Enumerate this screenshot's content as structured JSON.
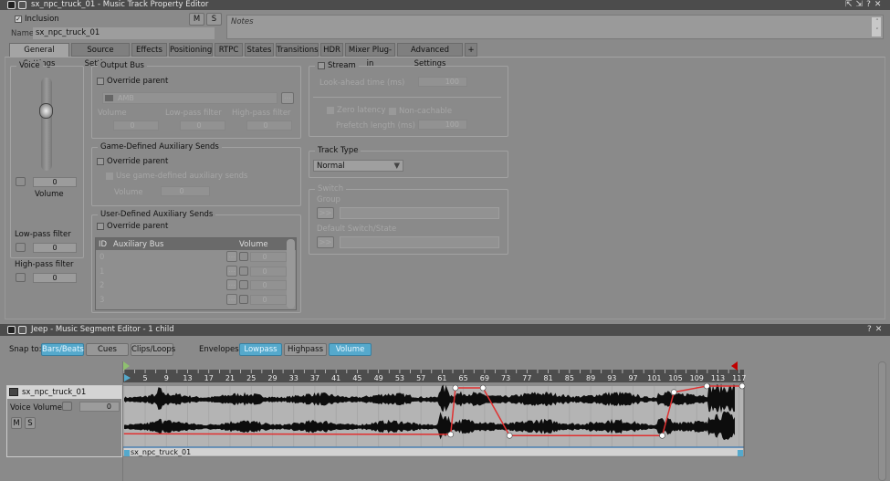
{
  "property_editor": {
    "title": "sx_npc_truck_01 - Music Track Property Editor",
    "inclusion_label": "Inclusion",
    "inclusion_checked": true,
    "mute_label": "M",
    "solo_label": "S",
    "name_label": "Name",
    "name_value": "sx_npc_truck_01",
    "notes_placeholder": "Notes",
    "window_buttons": [
      "float-icon",
      "dock-icon",
      "?",
      "×"
    ],
    "tabs": [
      "General Settings",
      "Source Settings",
      "Effects",
      "Positioning",
      "RTPC",
      "States",
      "Transitions",
      "HDR",
      "Mixer Plug-in",
      "Advanced Settings",
      "+"
    ],
    "active_tab": "General Settings",
    "voice": {
      "title": "Voice",
      "volume_value": "0",
      "volume_label": "Volume",
      "lowpass_label": "Low-pass filter",
      "lowpass_value": "0",
      "highpass_label": "High-pass filter",
      "highpass_value": "0"
    },
    "output_bus": {
      "title": "Output Bus",
      "override_label": "Override parent",
      "bus_name": "AMB",
      "browse_label": "...",
      "volume_label": "Volume",
      "volume_value": "0",
      "lowpass_label": "Low-pass filter",
      "lowpass_value": "0",
      "highpass_label": "High-pass filter",
      "highpass_value": "0"
    },
    "game_aux": {
      "title": "Game-Defined Auxiliary Sends",
      "override_label": "Override parent",
      "use_label": "Use game-defined auxiliary sends",
      "volume_label": "Volume",
      "volume_value": "0"
    },
    "user_aux": {
      "title": "User-Defined Auxiliary Sends",
      "override_label": "Override parent",
      "columns": [
        "ID",
        "Auxiliary Bus",
        "Volume"
      ],
      "rows": [
        {
          "id": "0",
          "bus": "",
          "volume": "0"
        },
        {
          "id": "1",
          "bus": "",
          "volume": "0"
        },
        {
          "id": "2",
          "bus": "",
          "volume": "0"
        },
        {
          "id": "3",
          "bus": "",
          "volume": "0"
        }
      ]
    },
    "stream": {
      "title": "Stream",
      "lookahead_label": "Look-ahead time (ms)",
      "lookahead_value": "100",
      "zero_latency_label": "Zero latency",
      "non_cachable_label": "Non-cachable",
      "prefetch_label": "Prefetch length (ms)",
      "prefetch_value": "100"
    },
    "track_type": {
      "title": "Track Type",
      "value": "Normal"
    },
    "switch": {
      "title": "Switch",
      "group_label": "Group",
      "default_label": "Default Switch/State",
      "arrow_label": ">>"
    }
  },
  "segment_editor": {
    "title": "Jeep - Music Segment Editor - 1 child",
    "window_buttons": [
      "?",
      "×"
    ],
    "snap_label": "Snap to:",
    "snap_buttons": [
      {
        "label": "Bars/Beats",
        "active": true
      },
      {
        "label": "Cues",
        "active": false
      },
      {
        "label": "Clips/Loops",
        "active": false
      }
    ],
    "envelopes_label": "Envelopes:",
    "envelope_buttons": [
      {
        "label": "Lowpass",
        "active": true
      },
      {
        "label": "Highpass",
        "active": false
      },
      {
        "label": "Volume",
        "active": true
      }
    ],
    "ruler_labels": [
      "5",
      "9",
      "13",
      "17",
      "21",
      "25",
      "29",
      "33",
      "37",
      "41",
      "45",
      "49",
      "53",
      "57",
      "61",
      "65",
      "69",
      "73",
      "77",
      "81",
      "85",
      "89",
      "93",
      "97",
      "101",
      "105",
      "109",
      "113",
      "117"
    ],
    "track": {
      "name": "sx_npc_truck_01",
      "voice_volume_label": "Voice Volume",
      "voice_volume_value": "0",
      "mute_label": "M",
      "solo_label": "S"
    },
    "clip_name": "sx_npc_truck_01",
    "envelope_points": [
      {
        "bar": 1,
        "level": 0.22
      },
      {
        "bar": 62.6,
        "level": 0.21
      },
      {
        "bar": 63.5,
        "level": 0.97
      },
      {
        "bar": 68.7,
        "level": 0.97
      },
      {
        "bar": 73.7,
        "level": 0.19
      },
      {
        "bar": 102.5,
        "level": 0.19
      },
      {
        "bar": 104.7,
        "level": 0.9
      },
      {
        "bar": 110.9,
        "level": 1.0
      },
      {
        "bar": 117.6,
        "level": 1.0
      }
    ],
    "colors": {
      "accent": "#55a9cc",
      "envelope": "#e03030",
      "end_marker": "#c00000",
      "start_marker": "#8fc070"
    }
  }
}
